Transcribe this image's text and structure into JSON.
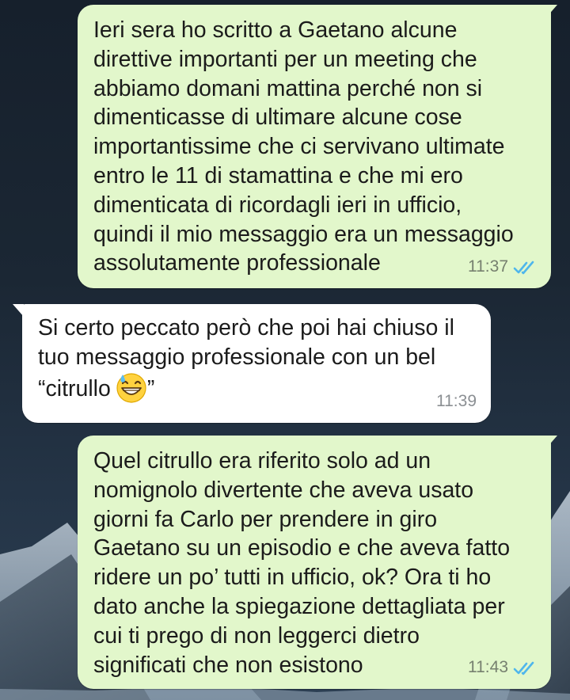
{
  "conversation": {
    "messages": [
      {
        "direction": "outgoing",
        "lines": [
          "Ieri sera ho scritto a Gaetano alcune",
          "direttive importanti per un meeting che",
          "abbiamo domani mattina perché non si",
          "dimenticasse di ultimare alcune cose",
          "importantissime che ci servivano ultimate",
          "entro le 11 di stamattina e che mi ero",
          "dimenticata di ricordagli ieri in ufficio,",
          "quindi il mio messaggio era un messaggio",
          "assolutamente professionale"
        ],
        "time": "11:37",
        "status": "read"
      },
      {
        "direction": "incoming",
        "lines": [
          "Si certo peccato però che poi hai chiuso il",
          "tuo messaggio professionale con un bel",
          "“citrullo"
        ],
        "line_end": "”",
        "emoji": "grinning-face-with-sweat-emoji",
        "time": "11:39"
      },
      {
        "direction": "outgoing",
        "lines": [
          "Quel citrullo era riferito solo ad un",
          "nomignolo divertente che aveva usato",
          "giorni fa Carlo per prendere in giro",
          "Gaetano su un episodio e che aveva fatto",
          "ridere un po’ tutti in ufficio, ok?  Ora ti ho",
          "dato anche la spiegazione dettagliata per",
          "cui ti prego di non leggerci dietro",
          "significati che non esistono"
        ],
        "time": "11:43",
        "status": "read"
      }
    ]
  },
  "colors": {
    "outgoing_bubble": "#e2f7cb",
    "incoming_bubble": "#ffffff",
    "read_tick": "#4fb6ec",
    "wallpaper": "#1b2734"
  },
  "icons": {
    "read_receipt": "double-check-icon",
    "emoji": "grinning-face-with-sweat-emoji"
  }
}
